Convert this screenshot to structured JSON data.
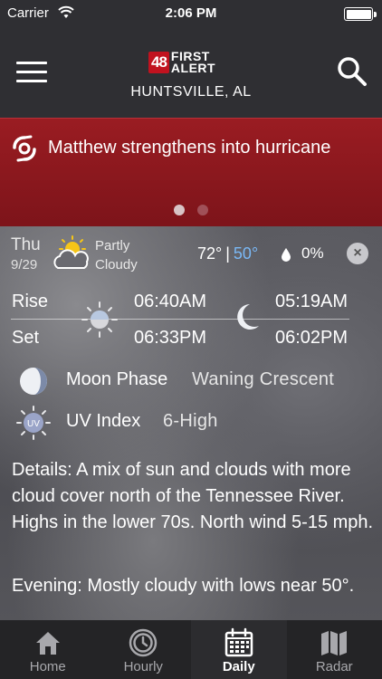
{
  "status_bar": {
    "carrier": "Carrier",
    "time": "2:06 PM"
  },
  "header": {
    "logo_number": "48",
    "logo_line1": "FIRST",
    "logo_line2": "ALERT",
    "city": "HUNTSVILLE, AL"
  },
  "banner": {
    "headline": "Matthew strengthens into hurricane",
    "page_count": 2,
    "active_page": 1
  },
  "forecast_day": {
    "day": "Thu",
    "date": "9/29",
    "condition_line1": "Partly",
    "condition_line2": "Cloudy",
    "icon": "partly-cloudy-icon",
    "high": "72°",
    "separator": "|",
    "low": "50°",
    "precip": "0%"
  },
  "sun_moon": {
    "rise_label": "Rise",
    "set_label": "Set",
    "sunrise": "06:40AM",
    "sunset": "06:33PM",
    "moonrise": "05:19AM",
    "moonset": "06:02PM"
  },
  "moon_phase": {
    "label": "Moon Phase",
    "value": "Waning Crescent"
  },
  "uv": {
    "icon_text": "UV",
    "label": "UV Index",
    "value": "6-High"
  },
  "details": "Details: A mix of sun and clouds with more cloud cover north of the Tennessee River. Highs in the lower 70s. North wind 5-15 mph.",
  "evening": "Evening: Mostly cloudy with lows near 50°.",
  "tabs": [
    {
      "label": "Home",
      "icon": "home-icon"
    },
    {
      "label": "Hourly",
      "icon": "clock-icon"
    },
    {
      "label": "Daily",
      "icon": "calendar-icon"
    },
    {
      "label": "Radar",
      "icon": "map-icon"
    }
  ],
  "colors": {
    "banner": "#8a181e",
    "low_temp": "#7ab8f5",
    "logo_red": "#c1121f"
  }
}
